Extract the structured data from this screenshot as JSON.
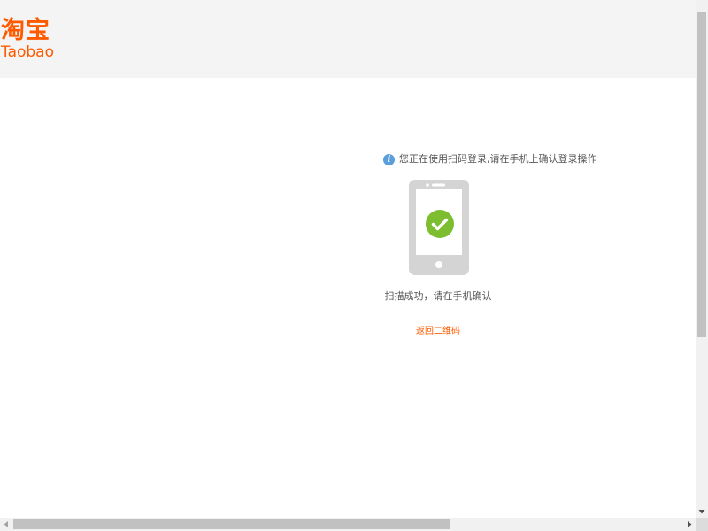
{
  "header": {
    "logo_cn": "淘宝",
    "logo_en": "Taobao"
  },
  "main": {
    "notice_icon": "info-icon",
    "notice_text": "您正在使用扫码登录,请在手机上确认登录操作",
    "phone_icon": "phone-icon",
    "check_icon": "check-icon",
    "status_text": "扫描成功，请在手机确认",
    "action_link": "返回二维码"
  },
  "colors": {
    "brand": "#ff5a00",
    "header_bg": "#f4f4f4",
    "info_blue": "#5a9fdb",
    "success_green": "#7cbe2f",
    "phone_gray": "#d4d4d4"
  }
}
